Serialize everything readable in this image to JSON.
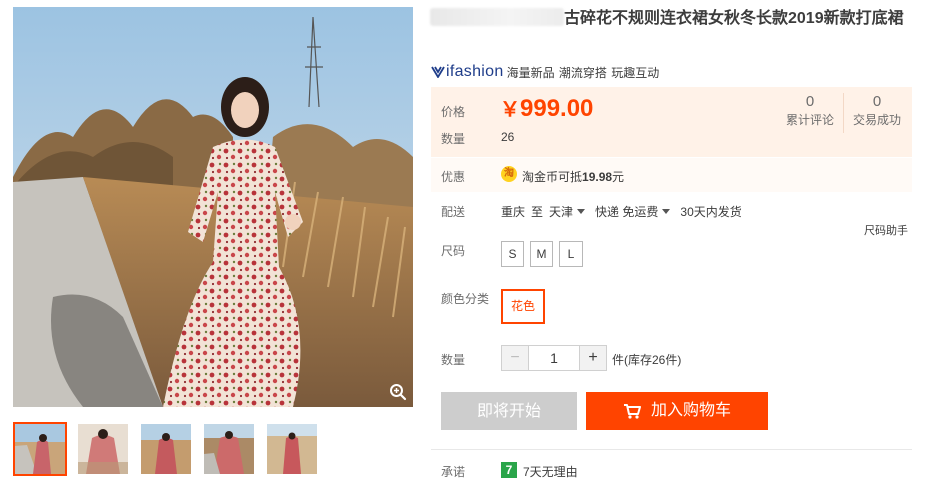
{
  "product": {
    "title": "古碎花不规则连衣裙女秋冬长款2019新款打底裙",
    "title_prefix_glyph": "米"
  },
  "brand": {
    "logo_text": "ifashion",
    "tags": "海量新品 潮流穿搭 玩趣互动",
    "color": "#1f3d8a"
  },
  "price": {
    "label": "价格",
    "currency": "￥",
    "value": "999.00",
    "qty_label": "数量",
    "qty_value": "26"
  },
  "stats": [
    {
      "count": "0",
      "label": "累计评论"
    },
    {
      "count": "0",
      "label": "交易成功"
    }
  ],
  "promo": {
    "label": "优惠",
    "coin_glyph": "淘",
    "text_prefix": "淘金币可抵",
    "amount": "19.98",
    "text_suffix": "元"
  },
  "shipping": {
    "label": "配送",
    "from": "重庆",
    "to_word": "至",
    "to": "天津",
    "method": "快递 免运费",
    "dispatch": "30天内发货"
  },
  "size_helper": "尺码助手",
  "size": {
    "label": "尺码",
    "options": [
      "S",
      "M",
      "L"
    ]
  },
  "color": {
    "label": "颜色分类",
    "options": [
      "花色"
    ]
  },
  "quantity": {
    "label": "数量",
    "value": "1",
    "minus": "−",
    "plus": "+",
    "stock_text": "件(库存26件)"
  },
  "buttons": {
    "buy": "即将开始",
    "cart": "加入购物车"
  },
  "promise": {
    "label": "承诺",
    "icon_glyph": "7",
    "text": "7天无理由"
  },
  "colors": {
    "accent": "#ff4400",
    "price_bg": "#fff2e8",
    "disabled": "#cdcdcd",
    "promise_green": "#2aa54a"
  },
  "icons": [
    "zoom-icon",
    "cart-icon",
    "ifashion-logo-icon",
    "taojinbi-coin-icon",
    "seven-day-icon"
  ]
}
